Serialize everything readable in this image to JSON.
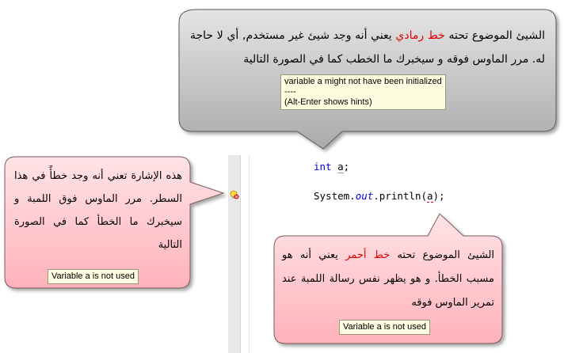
{
  "callout_top": {
    "line1_a": "الشيئ الموضوع تحته",
    "line1_hl": "خط رمادي",
    "line1_b": "يعني أنه وجد شيئ غير مستخدم, أي",
    "line2": "لا حاجة له. مرر الماوس فوقه و سيخبرك ما الخطب كما في الصورة التالية",
    "tooltip": [
      "variable a might not have been initialized",
      "----",
      "(Alt-Enter shows hints)"
    ]
  },
  "callout_left": {
    "text": "هذه الإشارة تعني أنه وجد خطأً في هذا السطر. مرر الماوس فوق اللمبة و سيخبرك ما الخطأ كما في الصورة التالية",
    "tooltip": "Variable a is not used"
  },
  "callout_right": {
    "line1_a": "الشيئ الموضوع تحته",
    "line1_hl": "خط أحمر",
    "line1_b": "يعني أنه",
    "rest": "هو مسبب الخطأ. و هو يظهر نفس رسالة اللمبة عند تمرير الماوس فوقه",
    "tooltip": "Variable a is not used"
  },
  "code": {
    "line1_kw": "int",
    "line1_var": "a",
    "line1_end": ";",
    "line2_obj": "System.",
    "line2_field": "out",
    "line2_call": ".println(",
    "line2_arg": "a",
    "line2_end": ");"
  },
  "colors": {
    "gray_bubble": "#c4c4c4",
    "pink_bubble": "#ffd0d4",
    "highlight": "#e60000",
    "keyword": "#0000e6"
  },
  "icons": {
    "gutter": "warning-bulb-icon"
  }
}
